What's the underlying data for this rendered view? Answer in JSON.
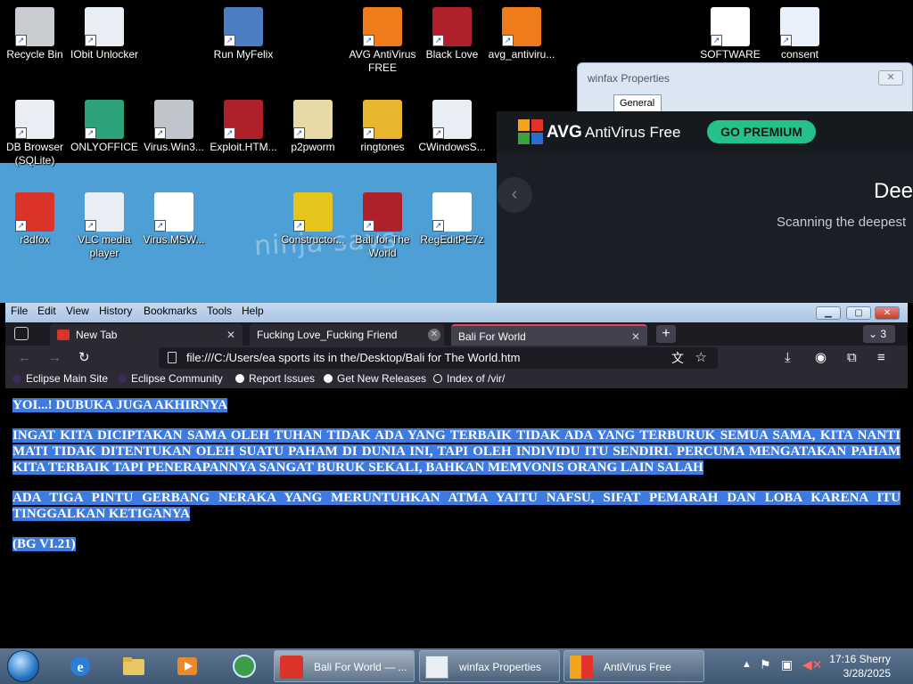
{
  "desktop": {
    "watermark": "ninja says",
    "icons": [
      {
        "label": "Recycle Bin",
        "color": "#c9ccd1"
      },
      {
        "label": "IObit Unlocker",
        "color": "#e8eef4"
      },
      {
        "label": "Run MyFelix",
        "color": "#4b7ec2"
      },
      {
        "label": "AVG AntiVirus FREE",
        "color": "#f07b1a"
      },
      {
        "label": "Black Love",
        "color": "#b0202a"
      },
      {
        "label": "avg_antiviru...",
        "color": "#f07b1a"
      },
      {
        "label": "SOFTWARE",
        "color": "#ffffff"
      },
      {
        "label": "consent",
        "color": "#e8f0fb"
      },
      {
        "label": "DB Browser (SQLite)",
        "color": "#e8eef4"
      },
      {
        "label": "ONLYOFFICE",
        "color": "#2da37a"
      },
      {
        "label": "Virus.Win3...",
        "color": "#c0c4cc"
      },
      {
        "label": "Exploit.HTM...",
        "color": "#b0202a"
      },
      {
        "label": "p2pworm",
        "color": "#e8d9a8"
      },
      {
        "label": "ringtones",
        "color": "#e8b62c"
      },
      {
        "label": "CWindowsS...",
        "color": "#e8eef4"
      },
      {
        "label": "r3dfox",
        "color": "#d9332a"
      },
      {
        "label": "VLC media player",
        "color": "#e8eef4"
      },
      {
        "label": "Virus.MSW...",
        "color": "#ffffff"
      },
      {
        "label": "Constructor...",
        "color": "#e6c51c"
      },
      {
        "label": "Bali for The World",
        "color": "#b0202a"
      },
      {
        "label": "RegEditPE7z",
        "color": "#ffffff"
      }
    ]
  },
  "winfax": {
    "title": "winfax Properties",
    "tab": "General"
  },
  "avg": {
    "brand": "AVG",
    "product": "AntiVirus Free",
    "premium": "GO PREMIUM",
    "heading": "Dee",
    "scanning": "Scanning the deepest"
  },
  "browser": {
    "menu": [
      "File",
      "Edit",
      "View",
      "History",
      "Bookmarks",
      "Tools",
      "Help"
    ],
    "tabs": [
      {
        "label": "New Tab"
      },
      {
        "label": "Fucking Love_Fucking Friend"
      },
      {
        "label": "Bali For World"
      }
    ],
    "tab_count": "3",
    "url": "file:///C:/Users/ea sports its in the/Desktop/Bali for The World.htm",
    "bookmarks": [
      "Eclipse Main Site",
      "Eclipse Community",
      "Report Issues",
      "Get New Releases",
      "Index of /vir/"
    ],
    "content": [
      "YOI...! DUBUKA JUGA AKHIRNYA",
      "INGAT KITA DICIPTAKAN SAMA OLEH TUHAN TIDAK ADA YANG TERBAIK TIDAK ADA YANG TERBURUK SEMUA SAMA, KITA NANTI MATI TIDAK DITENTUKAN OLEH SUATU PAHAM DI DUNIA INI, TAPI OLEH INDIVIDU ITU SENDIRI. PERCUMA MENGATAKAN PAHAM KITA TERBAIK TAPI PENERAPANNYA SANGAT BURUK SEKALI, BAHKAN MEMVONIS ORANG LAIN SALAH",
      "ADA TIGA PINTU GERBANG NERAKA YANG MERUNTUHKAN ATMA YAITU NAFSU, SIFAT PEMARAH DAN LOBA KARENA ITU TINGGALKAN KETIGANYA",
      "(BG VI.21)"
    ]
  },
  "taskbar": {
    "tasks": [
      "Bali For World — ...",
      "winfax Properties",
      "AntiVirus Free"
    ],
    "time": "17:16 Sherry",
    "date": "3/28/2025"
  }
}
